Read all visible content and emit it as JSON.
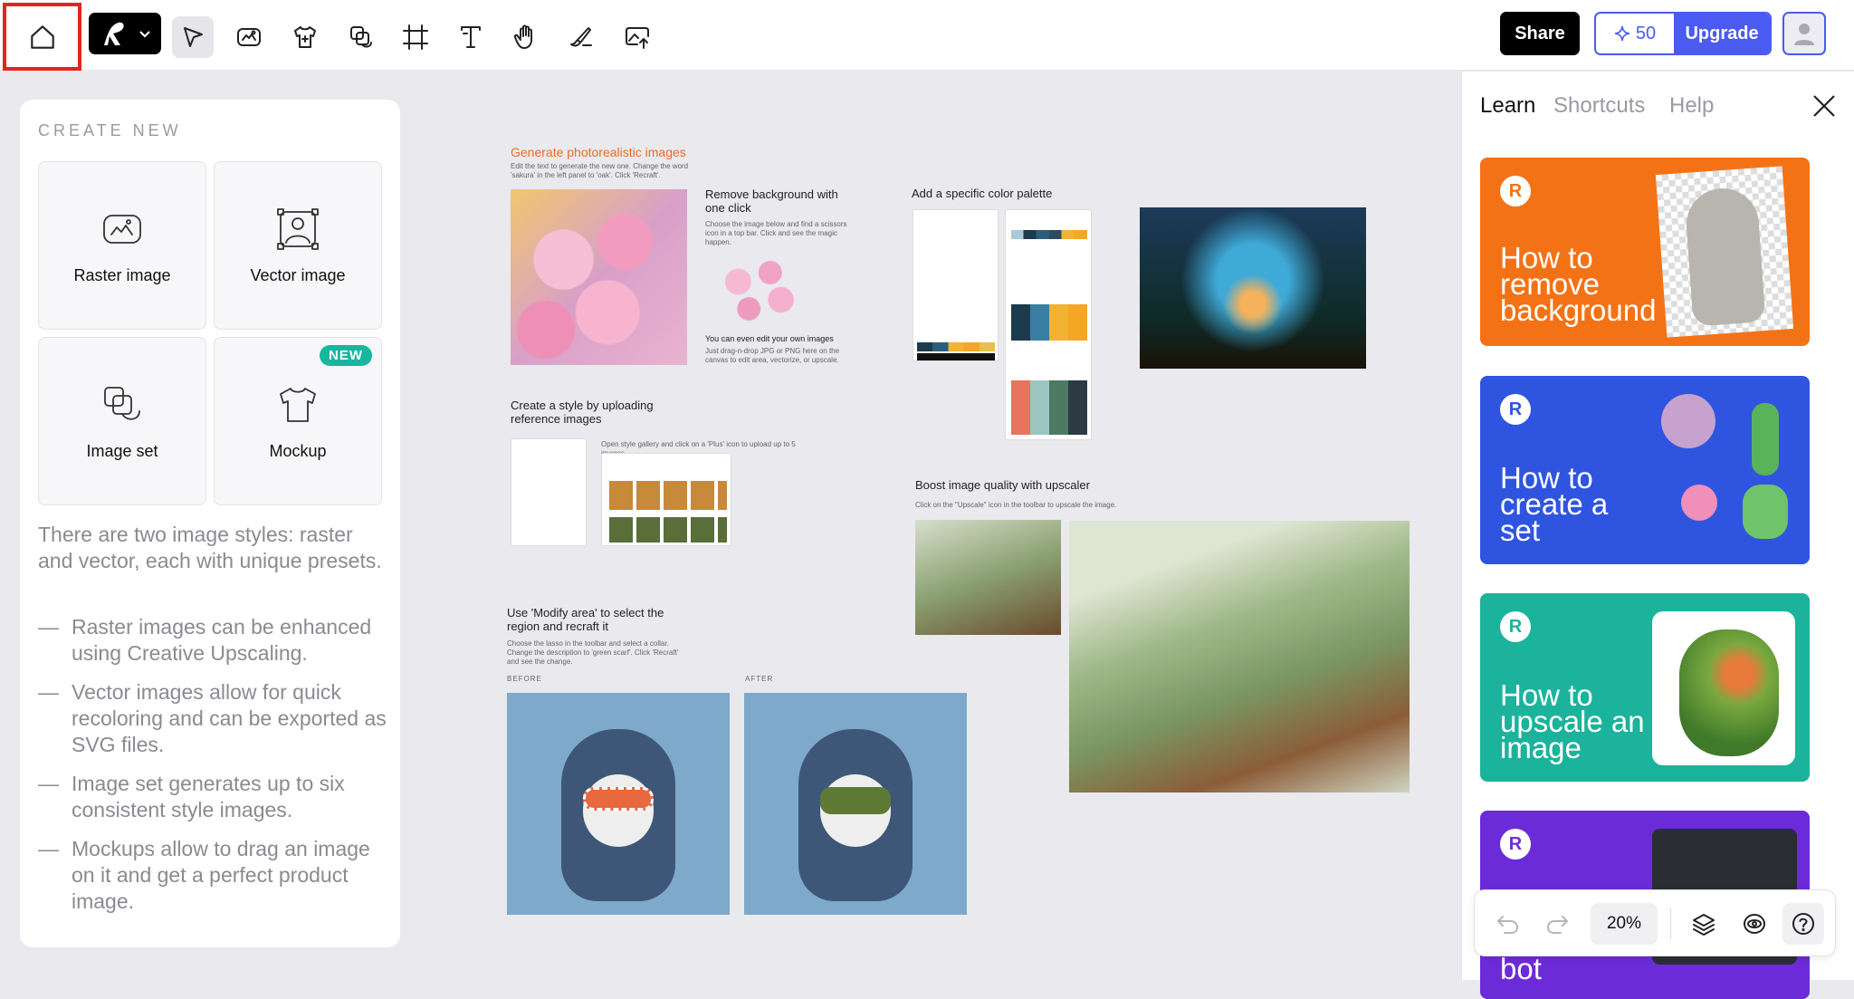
{
  "topbar": {
    "share_label": "Share",
    "credits_value": "50",
    "upgrade_label": "Upgrade"
  },
  "left_panel": {
    "section_title": "CREATE NEW",
    "tiles": [
      {
        "label": "Raster image",
        "icon": "raster-image-icon"
      },
      {
        "label": "Vector image",
        "icon": "vector-image-icon"
      },
      {
        "label": "Image set",
        "icon": "image-set-icon"
      },
      {
        "label": "Mockup",
        "icon": "mockup-icon",
        "badge": "NEW"
      }
    ],
    "description": "There are two image styles: raster and vector, each with unique presets.",
    "bullets": [
      "Raster images can be enhanced using Creative Upscaling.",
      "Vector images allow for quick recoloring and can be exported as SVG files.",
      "Image set generates up to six consistent style images.",
      "Mockups allow to drag an image on it and get a perfect product image."
    ]
  },
  "canvas": {
    "photoreal_title": "Generate photorealistic images",
    "photoreal_sub": "Edit the text to generate the new one. Change the word 'sakura' in the left panel to 'oak'. Click 'Recraft'.",
    "remove_bg_title": "Remove background with one click",
    "remove_bg_sub": "Choose the image below and find a scissors icon in a top bar. Click and see the magic happen.",
    "own_images_title": "You can even edit your own images",
    "own_images_sub": "Just drag-n-drop JPG or PNG here on the canvas to edit area, vectorize, or upscale.",
    "palette_title": "Add a specific color palette",
    "style_title": "Create a style by uploading reference images",
    "style_sub": "Open style gallery and click on a 'Plus' icon to upload up to 5 images.",
    "upscale_title": "Boost image quality with upscaler",
    "upscale_sub": "Click on the \"Upscale\" icon in the toolbar to upscale the image.",
    "modify_title": "Use 'Modify area' to select the region and recraft it",
    "modify_sub": "Choose the lasso in the toolbar and select a collar. Change the description to 'green scarf'. Click 'Recraft' and see the change.",
    "before_label": "BEFORE",
    "after_label": "AFTER"
  },
  "right_panel": {
    "tabs": [
      "Learn",
      "Shortcuts",
      "Help"
    ],
    "cards": [
      {
        "title": "How to remove background",
        "color": "#f47216"
      },
      {
        "title": "How to create a set",
        "color": "#2f55e0"
      },
      {
        "title": "How to upscale an image",
        "color": "#1bb39b"
      },
      {
        "title": "bot",
        "color": "#6c2bd9"
      }
    ]
  },
  "bottom_bar": {
    "zoom": "20%"
  }
}
